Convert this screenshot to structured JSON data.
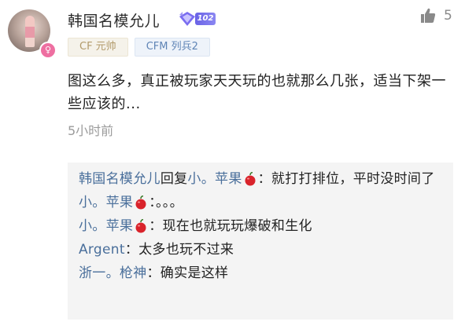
{
  "user": {
    "name": "韩国名模允儿",
    "level": "102",
    "tags": [
      "CF 元帅",
      "CFM 列兵2"
    ],
    "gender_symbol": "♀"
  },
  "likes": {
    "count": "5"
  },
  "comment": {
    "text": "图这么多，真正被玩家天天玩的也就那么几张，适当下架一些应该的...",
    "time": "5小时前"
  },
  "replies": {
    "items": [
      {
        "name": "韩国名模允儿",
        "reply_word": "回复",
        "target": "小。苹果",
        "target_apple": true,
        "text": "：就打打排位，平时没时间了"
      },
      {
        "name": "小。苹果",
        "name_apple": true,
        "text": "：。。。"
      },
      {
        "name": "小。苹果",
        "name_apple": true,
        "text": "：现在也就玩玩爆破和生化"
      },
      {
        "name": "Argent",
        "text": "：太多也玩不过来"
      },
      {
        "name": "浙一。枪神",
        "text": "：确实是这样"
      }
    ]
  },
  "colors": {
    "link_name": "#4a6f9b",
    "gender_pink": "#ee6fa1",
    "badge_purple": "#6a63e6",
    "apple_red": "#d9232b"
  }
}
